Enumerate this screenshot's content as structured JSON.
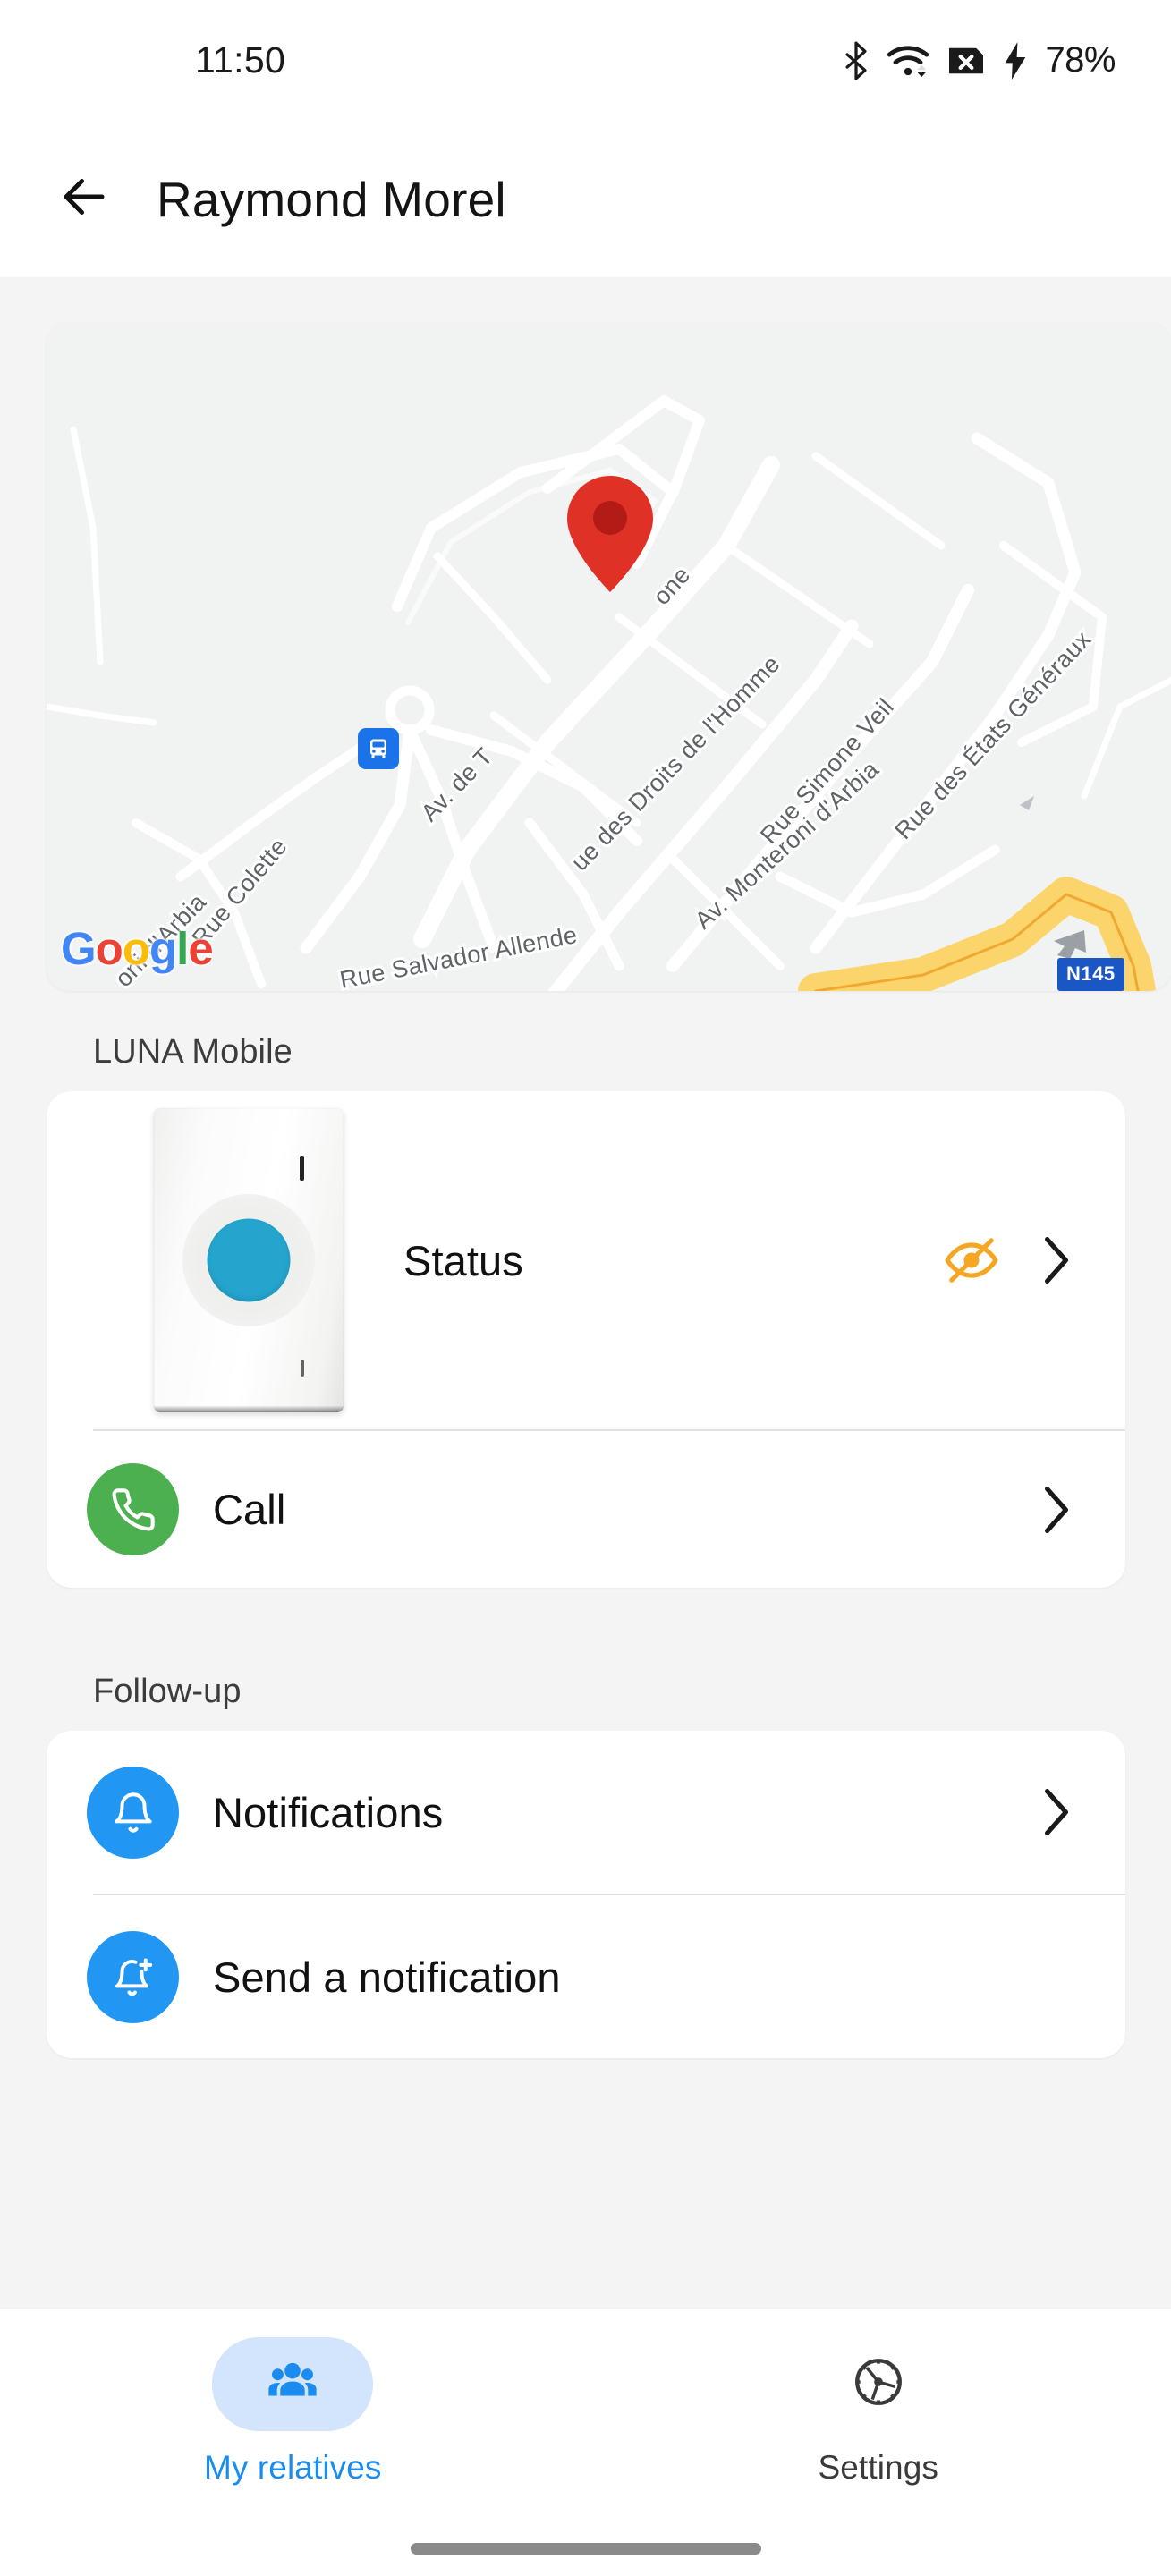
{
  "statusbar": {
    "time": "11:50",
    "battery": "78%",
    "icons": [
      "bluetooth-icon",
      "wifi-icon",
      "sim-missing-icon",
      "charging-bolt-icon"
    ]
  },
  "appbar": {
    "back_label": "back-arrow-icon",
    "title": "Raymond Morel"
  },
  "map": {
    "provider": "Google",
    "logo_letters": [
      "G",
      "o",
      "o",
      "g",
      "l",
      "e"
    ],
    "marker": "location-pin",
    "marker_color": "#E03127",
    "transit_badge": "bus-stop-icon",
    "highway_shield": "N145",
    "streets": [
      "Av. de Tarragone",
      "Rue des États Généraux",
      "Rue Simone Veil",
      "Rue des Droits de l'Homme",
      "Av. Monteroni d'Arbia",
      "Rue Colette",
      "Rue Salvador Allende",
      "Rue Salvador Allende",
      "oni d'Arbia"
    ]
  },
  "sections": [
    {
      "label": "LUNA Mobile",
      "rows": [
        {
          "label": "Status",
          "trailing_icon": "eye-off-icon",
          "trailing_color": "#F5A623",
          "chevron": true
        },
        {
          "label": "Call",
          "icon": "phone-icon",
          "icon_bg": "#4CAF50",
          "chevron": true
        }
      ]
    },
    {
      "label": "Follow-up",
      "rows": [
        {
          "label": "Notifications",
          "icon": "bell-icon",
          "icon_bg": "#2196F3",
          "chevron": true
        },
        {
          "label": "Send a notification",
          "icon": "bell-plus-icon",
          "icon_bg": "#2196F3",
          "chevron": false
        }
      ]
    }
  ],
  "bottomnav": {
    "items": [
      {
        "label": "My relatives",
        "icon": "people-group-icon",
        "active": true
      },
      {
        "label": "Settings",
        "icon": "gear-icon",
        "active": false
      }
    ]
  },
  "colors": {
    "accent": "#1a8cf0",
    "active_pill": "#D3E4FD",
    "page_bg": "#f4f4f4",
    "card_bg": "#ffffff"
  }
}
